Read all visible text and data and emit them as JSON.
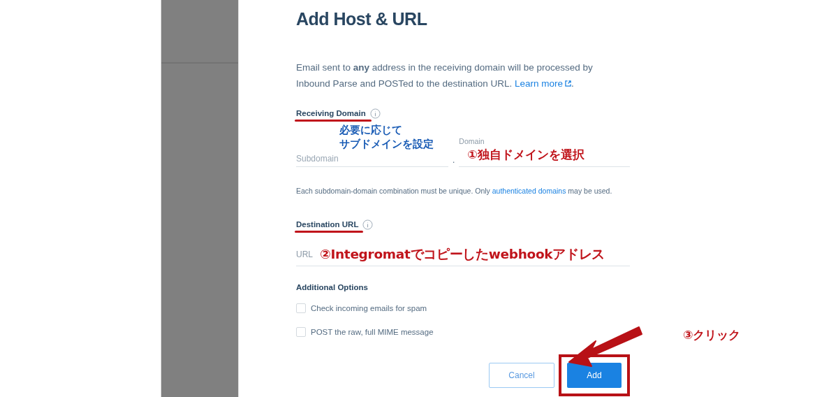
{
  "page": {
    "title": "Add Host & URL",
    "description": "Email sent to **any** address in the receiving domain will be processed by Inbound Parse and POSTed to the destination URL.",
    "learn_more_link": "Learn more",
    "description_end": "."
  },
  "receiving_domain": {
    "label": "Receiving Domain",
    "subdomain_placeholder": "Subdomain",
    "domain_label": "Domain",
    "separator": ".",
    "help_text": "Each subdomain-domain combination must be unique. Only",
    "help_link": "authenticated domains",
    "help_text_end": "may be used."
  },
  "destination": {
    "label": "Destination URL",
    "url_label": "URL"
  },
  "options": {
    "title": "Additional Options",
    "items": [
      {
        "label": "Check incoming emails for spam",
        "checked": false
      },
      {
        "label": "POST the raw, full MIME message",
        "checked": false
      }
    ]
  },
  "buttons": {
    "cancel": "Cancel",
    "add": "Add"
  },
  "annotations": {
    "subdomain_note": [
      "必要に応じて",
      "サブドメインを設定"
    ],
    "domain_note": "①独自ドメインを選択",
    "url_note": "②Integromatでコピーしたwebhookアドレス",
    "click_note": "③クリック"
  }
}
